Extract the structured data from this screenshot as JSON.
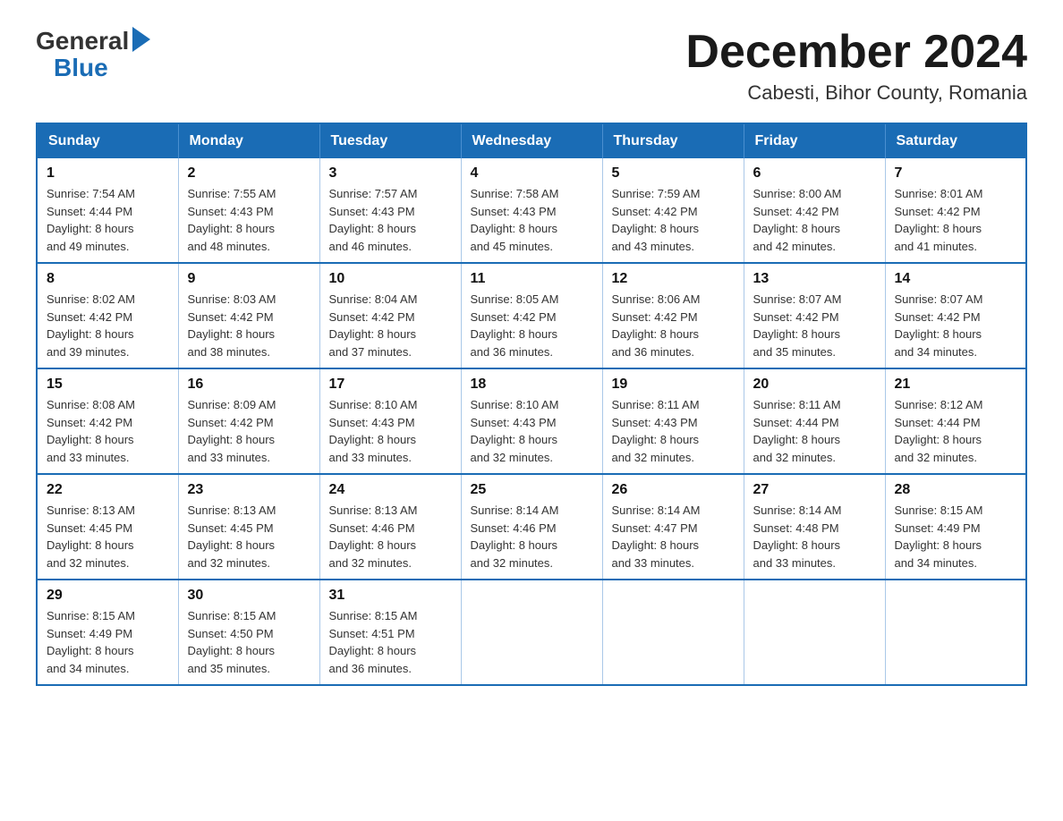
{
  "logo": {
    "general": "General",
    "blue": "Blue",
    "arrow": "▶"
  },
  "title": {
    "month": "December 2024",
    "location": "Cabesti, Bihor County, Romania"
  },
  "headers": [
    "Sunday",
    "Monday",
    "Tuesday",
    "Wednesday",
    "Thursday",
    "Friday",
    "Saturday"
  ],
  "weeks": [
    [
      {
        "day": "1",
        "sunrise": "7:54 AM",
        "sunset": "4:44 PM",
        "daylight": "8 hours and 49 minutes."
      },
      {
        "day": "2",
        "sunrise": "7:55 AM",
        "sunset": "4:43 PM",
        "daylight": "8 hours and 48 minutes."
      },
      {
        "day": "3",
        "sunrise": "7:57 AM",
        "sunset": "4:43 PM",
        "daylight": "8 hours and 46 minutes."
      },
      {
        "day": "4",
        "sunrise": "7:58 AM",
        "sunset": "4:43 PM",
        "daylight": "8 hours and 45 minutes."
      },
      {
        "day": "5",
        "sunrise": "7:59 AM",
        "sunset": "4:42 PM",
        "daylight": "8 hours and 43 minutes."
      },
      {
        "day": "6",
        "sunrise": "8:00 AM",
        "sunset": "4:42 PM",
        "daylight": "8 hours and 42 minutes."
      },
      {
        "day": "7",
        "sunrise": "8:01 AM",
        "sunset": "4:42 PM",
        "daylight": "8 hours and 41 minutes."
      }
    ],
    [
      {
        "day": "8",
        "sunrise": "8:02 AM",
        "sunset": "4:42 PM",
        "daylight": "8 hours and 39 minutes."
      },
      {
        "day": "9",
        "sunrise": "8:03 AM",
        "sunset": "4:42 PM",
        "daylight": "8 hours and 38 minutes."
      },
      {
        "day": "10",
        "sunrise": "8:04 AM",
        "sunset": "4:42 PM",
        "daylight": "8 hours and 37 minutes."
      },
      {
        "day": "11",
        "sunrise": "8:05 AM",
        "sunset": "4:42 PM",
        "daylight": "8 hours and 36 minutes."
      },
      {
        "day": "12",
        "sunrise": "8:06 AM",
        "sunset": "4:42 PM",
        "daylight": "8 hours and 36 minutes."
      },
      {
        "day": "13",
        "sunrise": "8:07 AM",
        "sunset": "4:42 PM",
        "daylight": "8 hours and 35 minutes."
      },
      {
        "day": "14",
        "sunrise": "8:07 AM",
        "sunset": "4:42 PM",
        "daylight": "8 hours and 34 minutes."
      }
    ],
    [
      {
        "day": "15",
        "sunrise": "8:08 AM",
        "sunset": "4:42 PM",
        "daylight": "8 hours and 33 minutes."
      },
      {
        "day": "16",
        "sunrise": "8:09 AM",
        "sunset": "4:42 PM",
        "daylight": "8 hours and 33 minutes."
      },
      {
        "day": "17",
        "sunrise": "8:10 AM",
        "sunset": "4:43 PM",
        "daylight": "8 hours and 33 minutes."
      },
      {
        "day": "18",
        "sunrise": "8:10 AM",
        "sunset": "4:43 PM",
        "daylight": "8 hours and 32 minutes."
      },
      {
        "day": "19",
        "sunrise": "8:11 AM",
        "sunset": "4:43 PM",
        "daylight": "8 hours and 32 minutes."
      },
      {
        "day": "20",
        "sunrise": "8:11 AM",
        "sunset": "4:44 PM",
        "daylight": "8 hours and 32 minutes."
      },
      {
        "day": "21",
        "sunrise": "8:12 AM",
        "sunset": "4:44 PM",
        "daylight": "8 hours and 32 minutes."
      }
    ],
    [
      {
        "day": "22",
        "sunrise": "8:13 AM",
        "sunset": "4:45 PM",
        "daylight": "8 hours and 32 minutes."
      },
      {
        "day": "23",
        "sunrise": "8:13 AM",
        "sunset": "4:45 PM",
        "daylight": "8 hours and 32 minutes."
      },
      {
        "day": "24",
        "sunrise": "8:13 AM",
        "sunset": "4:46 PM",
        "daylight": "8 hours and 32 minutes."
      },
      {
        "day": "25",
        "sunrise": "8:14 AM",
        "sunset": "4:46 PM",
        "daylight": "8 hours and 32 minutes."
      },
      {
        "day": "26",
        "sunrise": "8:14 AM",
        "sunset": "4:47 PM",
        "daylight": "8 hours and 33 minutes."
      },
      {
        "day": "27",
        "sunrise": "8:14 AM",
        "sunset": "4:48 PM",
        "daylight": "8 hours and 33 minutes."
      },
      {
        "day": "28",
        "sunrise": "8:15 AM",
        "sunset": "4:49 PM",
        "daylight": "8 hours and 34 minutes."
      }
    ],
    [
      {
        "day": "29",
        "sunrise": "8:15 AM",
        "sunset": "4:49 PM",
        "daylight": "8 hours and 34 minutes."
      },
      {
        "day": "30",
        "sunrise": "8:15 AM",
        "sunset": "4:50 PM",
        "daylight": "8 hours and 35 minutes."
      },
      {
        "day": "31",
        "sunrise": "8:15 AM",
        "sunset": "4:51 PM",
        "daylight": "8 hours and 36 minutes."
      },
      null,
      null,
      null,
      null
    ]
  ],
  "labels": {
    "sunrise": "Sunrise:",
    "sunset": "Sunset:",
    "daylight": "Daylight:"
  }
}
